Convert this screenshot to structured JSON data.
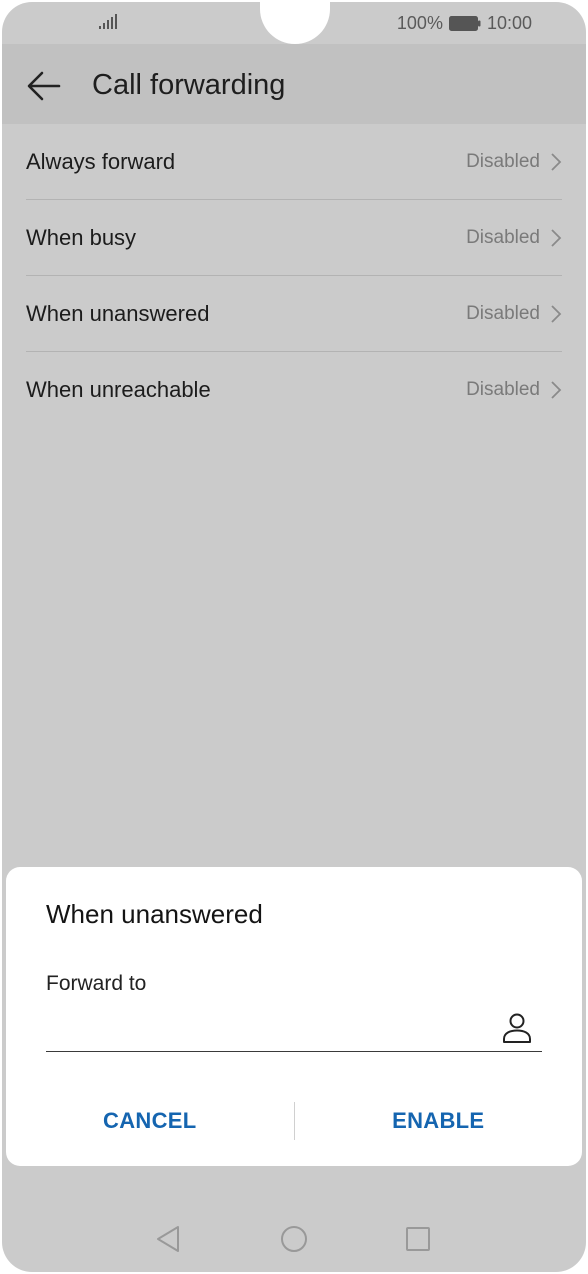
{
  "status_bar": {
    "battery_text": "100%",
    "time": "10:00",
    "icons": [
      "signal-icon",
      "battery-icon"
    ]
  },
  "header": {
    "title": "Call forwarding",
    "back_icon": "arrow-left-icon"
  },
  "list": {
    "items": [
      {
        "label": "Always forward",
        "value": "Disabled"
      },
      {
        "label": "When busy",
        "value": "Disabled"
      },
      {
        "label": "When unanswered",
        "value": "Disabled"
      },
      {
        "label": "When unreachable",
        "value": "Disabled"
      }
    ]
  },
  "dialog": {
    "title": "When unanswered",
    "field_label": "Forward to",
    "field_value": "",
    "contact_icon": "person-icon",
    "cancel_label": "CANCEL",
    "enable_label": "ENABLE",
    "accent_color": "#1565b0"
  },
  "nav_bar": {
    "icons": [
      "nav-back-icon",
      "nav-home-icon",
      "nav-recent-icon"
    ]
  },
  "colors": {
    "overlay_background": "#cbcbcb",
    "header_background": "#c1c1c1",
    "dialog_background": "#ffffff"
  }
}
